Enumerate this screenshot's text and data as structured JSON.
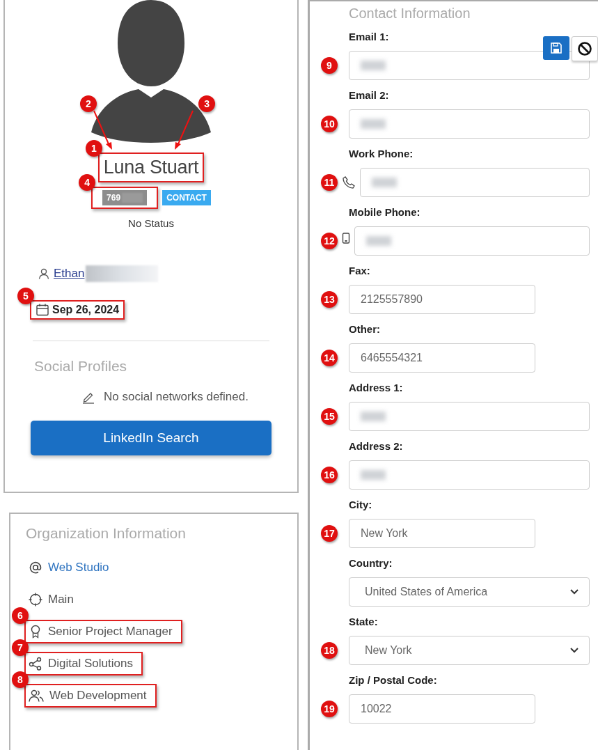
{
  "profile": {
    "name": {
      "text": "Luna Stuart",
      "highlighted": true,
      "callout": "1"
    },
    "arrow_callouts": [
      "2",
      "3"
    ],
    "id_badge": {
      "text": "769",
      "highlighted": true,
      "callout": "4",
      "blurred": true
    },
    "type_badge": "CONTACT",
    "status": "No Status",
    "owner": {
      "text": "Ethan",
      "surname_blurred": true
    },
    "date": {
      "text": "Sep 26, 2024",
      "highlighted": true,
      "callout": "5"
    },
    "social": {
      "title": "Social Profiles",
      "empty_text": "No social networks defined.",
      "button": "LinkedIn Search"
    }
  },
  "organization": {
    "title": "Organization Information",
    "items": [
      {
        "kind": "company",
        "text": "Web Studio",
        "link": true,
        "highlighted": false
      },
      {
        "kind": "location",
        "text": "Main",
        "link": false,
        "highlighted": false
      },
      {
        "kind": "title",
        "text": "Senior Project Manager",
        "link": false,
        "highlighted": true,
        "callout": "6"
      },
      {
        "kind": "department",
        "text": "Digital Solutions",
        "link": false,
        "highlighted": true,
        "callout": "7"
      },
      {
        "kind": "team",
        "text": "Web Development",
        "link": false,
        "highlighted": true,
        "callout": "8"
      }
    ]
  },
  "contact": {
    "title": "Contact Information",
    "fields": [
      {
        "label": "Email 1:",
        "kind": "long",
        "callout": "9",
        "blurred": true
      },
      {
        "label": "Email 2:",
        "kind": "long",
        "callout": "10",
        "blurred": true
      },
      {
        "label": "Work Phone:",
        "kind": "phone",
        "callout": "11",
        "blurred": true
      },
      {
        "label": "Mobile Phone:",
        "kind": "mobile",
        "callout": "12",
        "blurred": true
      },
      {
        "label": "Fax:",
        "kind": "short",
        "callout": "13",
        "value": "2125557890"
      },
      {
        "label": "Other:",
        "kind": "short",
        "callout": "14",
        "value": "6465554321"
      },
      {
        "label": "Address 1:",
        "kind": "long",
        "callout": "15",
        "blurred": true
      },
      {
        "label": "Address 2:",
        "kind": "long",
        "callout": "16",
        "blurred": true
      },
      {
        "label": "City:",
        "kind": "short",
        "callout": "17",
        "value": "New York"
      },
      {
        "label": "Country:",
        "kind": "select",
        "value": "United States of America"
      },
      {
        "label": "State:",
        "kind": "select",
        "callout": "18",
        "value": "New York"
      },
      {
        "label": "Zip / Postal Code:",
        "kind": "short",
        "callout": "19",
        "value": "10022"
      }
    ]
  }
}
